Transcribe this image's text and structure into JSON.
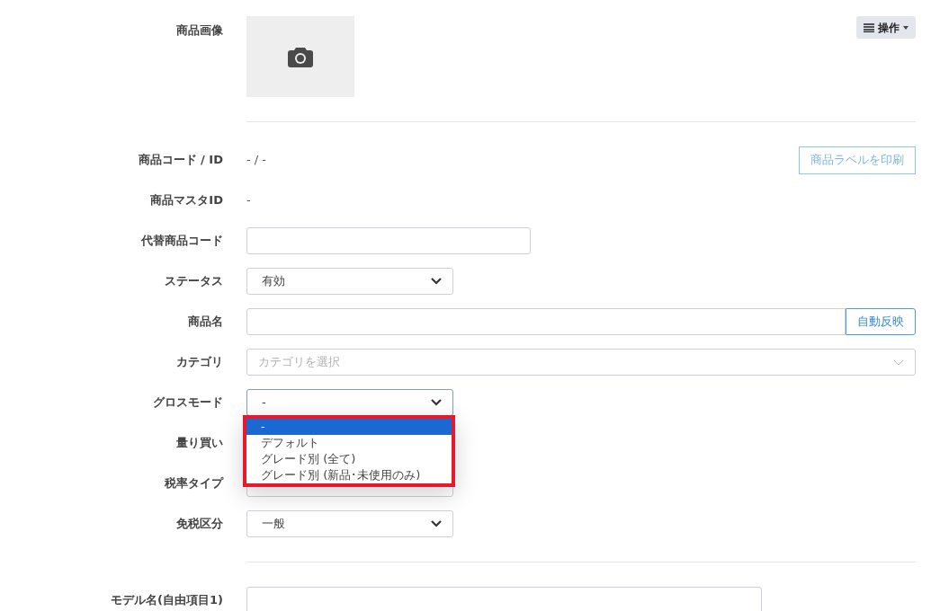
{
  "image_row": {
    "label": "商品画像",
    "menu_button": "操作"
  },
  "rows": [
    {
      "kind": "text",
      "label": "商品コード / ID",
      "value": "- / -",
      "button": "商品ラベルを印刷"
    },
    {
      "kind": "text",
      "label": "商品マスタID",
      "value": "-"
    },
    {
      "kind": "input",
      "label": "代替商品コード"
    },
    {
      "kind": "select",
      "label": "ステータス",
      "value": "有効"
    },
    {
      "kind": "input_button",
      "label": "商品名",
      "button": "自動反映"
    },
    {
      "kind": "combo",
      "label": "カテゴリ",
      "placeholder": "カテゴリを選択"
    },
    {
      "kind": "select",
      "label": "グロスモード",
      "value": "-",
      "open": true,
      "options": [
        {
          "label": "-",
          "selected": true
        },
        {
          "label": "デフォルト",
          "selected": false
        },
        {
          "label": "グレード別 (全て)",
          "selected": false
        },
        {
          "label": "グレード別 (新品･未使用のみ)",
          "selected": false
        }
      ]
    },
    {
      "kind": "hidden",
      "label": "量り買い"
    },
    {
      "kind": "select",
      "label": "税率タイプ"
    },
    {
      "kind": "select",
      "label": "免税区分",
      "value": "一般"
    }
  ],
  "bottom_rows": [
    {
      "kind": "input",
      "label": "モデル名(自由項目1)"
    }
  ]
}
